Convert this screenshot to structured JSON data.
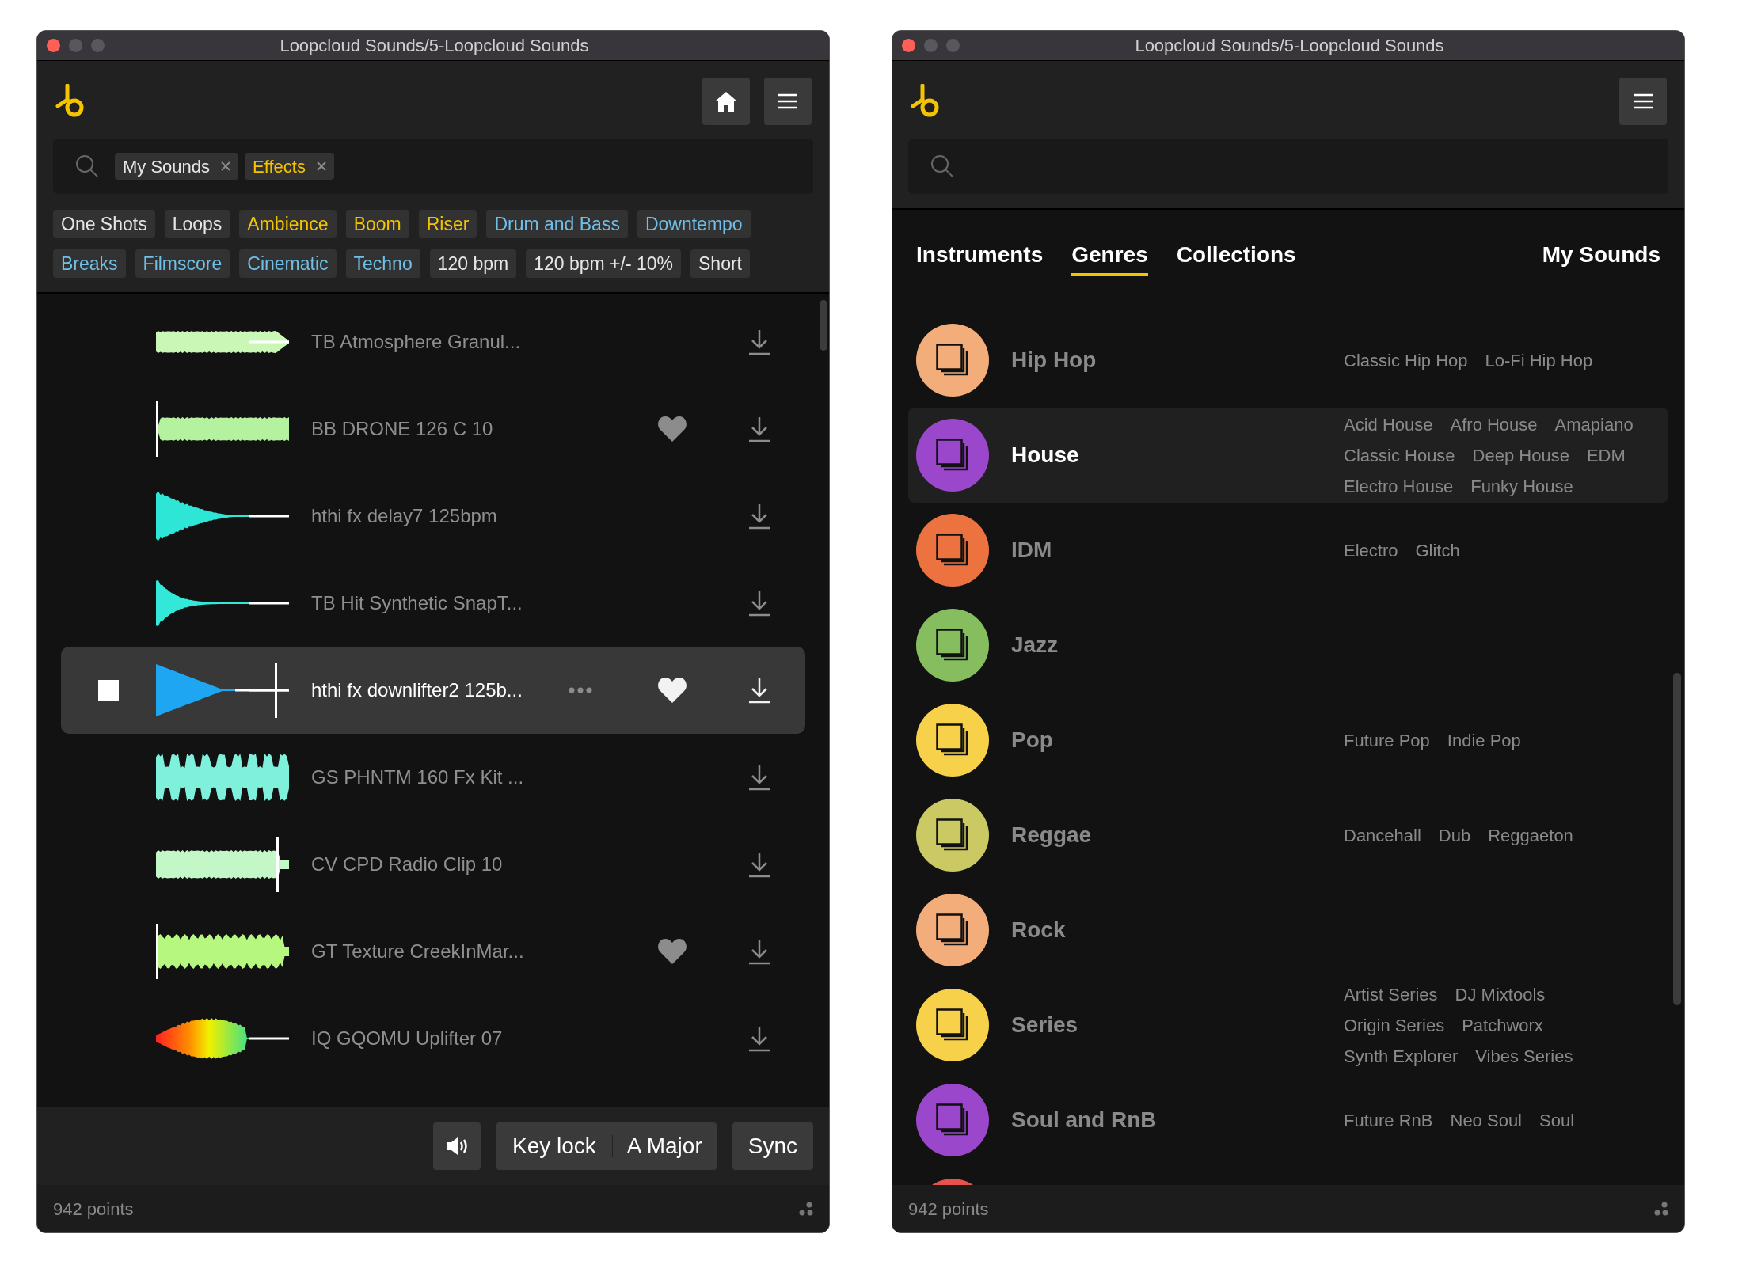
{
  "windows": [
    {
      "title": "Loopcloud Sounds/5-Loopcloud Sounds",
      "header_buttons": [
        {
          "kind": "home"
        },
        {
          "kind": "menu"
        }
      ],
      "search": {
        "chips": [
          {
            "label": "My Sounds",
            "kind": "neutral"
          },
          {
            "label": "Effects",
            "kind": "accent"
          }
        ]
      },
      "filter_tags": [
        {
          "label": "One Shots",
          "kind": "neutral"
        },
        {
          "label": "Loops",
          "kind": "neutral"
        },
        {
          "label": "Ambience",
          "kind": "accent"
        },
        {
          "label": "Boom",
          "kind": "accent"
        },
        {
          "label": "Riser",
          "kind": "accent"
        },
        {
          "label": "Drum and Bass",
          "kind": "genre"
        },
        {
          "label": "Downtempo",
          "kind": "genre"
        },
        {
          "label": "Breaks",
          "kind": "genre"
        },
        {
          "label": "Filmscore",
          "kind": "genre"
        },
        {
          "label": "Cinematic",
          "kind": "genre"
        },
        {
          "label": "Techno",
          "kind": "genre"
        },
        {
          "label": "120 bpm",
          "kind": "neutral"
        },
        {
          "label": "120 bpm +/- 10%",
          "kind": "neutral"
        },
        {
          "label": "Short",
          "kind": "neutral"
        }
      ],
      "sounds": [
        {
          "name": "TB Atmosphere Granul...",
          "kind": "pad",
          "favorite": false,
          "selected": false
        },
        {
          "name": "BB DRONE 126 C 10",
          "kind": "drone",
          "favorite": true,
          "selected": false
        },
        {
          "name": "hthi fx delay7 125bpm",
          "kind": "decay",
          "favorite": false,
          "selected": false
        },
        {
          "name": "TB Hit Synthetic SnapT...",
          "kind": "hit",
          "favorite": false,
          "selected": false
        },
        {
          "name": "hthi fx downlifter2 125b...",
          "kind": "sweep",
          "favorite": true,
          "selected": true
        },
        {
          "name": "GS PHNTM 160 Fx Kit ...",
          "kind": "chop",
          "favorite": false,
          "selected": false
        },
        {
          "name": "CV CPD Radio Clip 10",
          "kind": "clip",
          "favorite": false,
          "selected": false
        },
        {
          "name": "GT Texture CreekInMar...",
          "kind": "texture",
          "favorite": true,
          "selected": false
        },
        {
          "name": "IQ GQOMU Uplifter 07",
          "kind": "riser",
          "favorite": false,
          "selected": false
        }
      ],
      "controls": {
        "key_lock": "Key lock",
        "key": "A Major",
        "sync": "Sync"
      },
      "status_bar": "942 points"
    },
    {
      "title": "Loopcloud Sounds/5-Loopcloud Sounds",
      "header_buttons": [
        {
          "kind": "menu"
        }
      ],
      "tabs": [
        {
          "label": "Instruments",
          "selected": false
        },
        {
          "label": "Genres",
          "selected": true
        },
        {
          "label": "Collections",
          "selected": false
        },
        {
          "label": "My Sounds",
          "selected": false
        }
      ],
      "genres": [
        {
          "name": "Hip Hop",
          "color": "#f3ad7a",
          "selected": false,
          "subgenres": [
            "Classic Hip Hop",
            "Lo-Fi Hip Hop"
          ]
        },
        {
          "name": "House",
          "color": "#9b47cc",
          "selected": true,
          "subgenres": [
            "Acid House",
            "Afro House",
            "Amapiano",
            "Classic House",
            "Deep House",
            "EDM",
            "Electro House",
            "Funky House"
          ]
        },
        {
          "name": "IDM",
          "color": "#ec7340",
          "selected": false,
          "subgenres": [
            "Electro",
            "Glitch"
          ]
        },
        {
          "name": "Jazz",
          "color": "#86bd5f",
          "selected": false
        },
        {
          "name": "Pop",
          "color": "#f8d14a",
          "selected": false,
          "subgenres": [
            "Future Pop",
            "Indie Pop"
          ]
        },
        {
          "name": "Reggae",
          "color": "#cbc964",
          "selected": false,
          "subgenres": [
            "Dancehall",
            "Dub",
            "Reggaeton"
          ]
        },
        {
          "name": "Rock",
          "color": "#f3ad7a",
          "selected": false
        },
        {
          "name": "Series",
          "color": "#f8d14a",
          "selected": false,
          "subgenres": [
            "Artist Series",
            "DJ Mixtools",
            "Origin Series",
            "Patchworx",
            "Synth Explorer",
            "Vibes Series"
          ]
        },
        {
          "name": "Soul and RnB",
          "color": "#9b47cc",
          "selected": false,
          "subgenres": [
            "Future RnB",
            "Neo Soul",
            "Soul"
          ]
        },
        {
          "color": "#e8524a",
          "selected": false
        }
      ],
      "status_bar": "942 points"
    }
  ]
}
